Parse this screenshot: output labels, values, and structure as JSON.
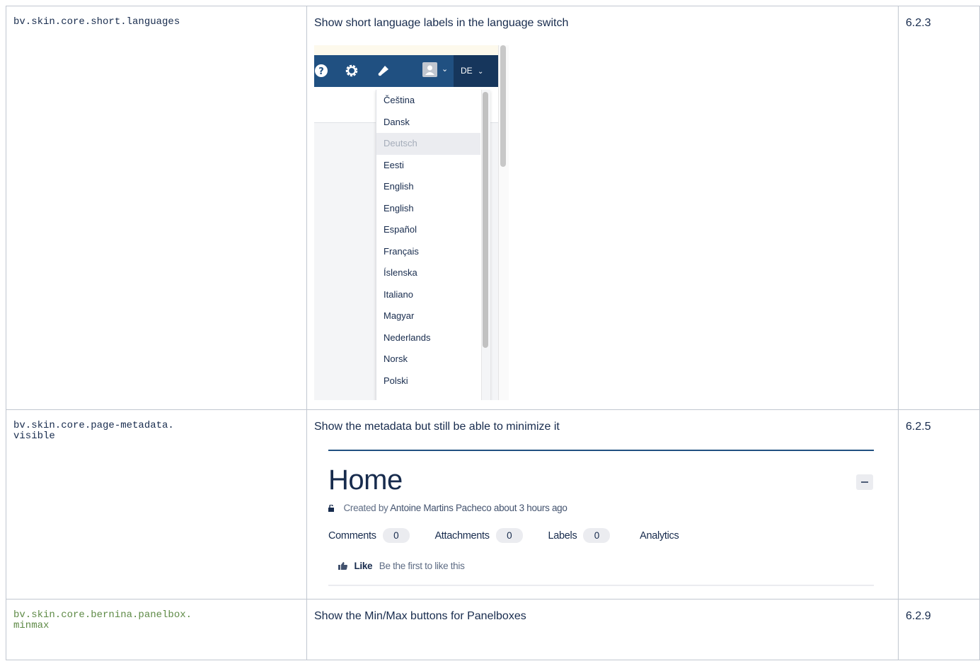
{
  "rows": [
    {
      "key": "bv.skin.core.short.languages",
      "description": "Show short language labels in the language switch",
      "version": "6.2.3"
    },
    {
      "key": "bv.skin.core.page-metadata.\nvisible",
      "description": "Show the metadata but still be able to minimize it",
      "version": "6.2.5"
    },
    {
      "key": "bv.skin.core.bernina.panelbox.\nminmax",
      "description": "Show the Min/Max buttons for Panelboxes",
      "version": "6.2.9"
    }
  ],
  "language_switch": {
    "current": "DE",
    "languages": [
      "Čeština",
      "Dansk",
      "Deutsch",
      "Eesti",
      "English",
      "English",
      "Español",
      "Français",
      "Íslenska",
      "Italiano",
      "Magyar",
      "Nederlands",
      "Norsk",
      "Polski"
    ],
    "selected": "Deutsch",
    "nav_icons": [
      "help-icon",
      "gear-icon",
      "bell-icon",
      "avatar-icon",
      "chevron-down-icon"
    ],
    "colors": {
      "navbar": "#205081",
      "switch": "#16365c"
    }
  },
  "metadata": {
    "title": "Home",
    "created_prefix": "Created by",
    "author": "Antoine Martins Pacheco",
    "created_suffix": "about 3 hours ago",
    "comments_label": "Comments",
    "comments_count": "0",
    "attachments_label": "Attachments",
    "attachments_count": "0",
    "labels_label": "Labels",
    "labels_count": "0",
    "analytics_label": "Analytics",
    "like_label": "Like",
    "like_text": "Be the first to like this"
  }
}
